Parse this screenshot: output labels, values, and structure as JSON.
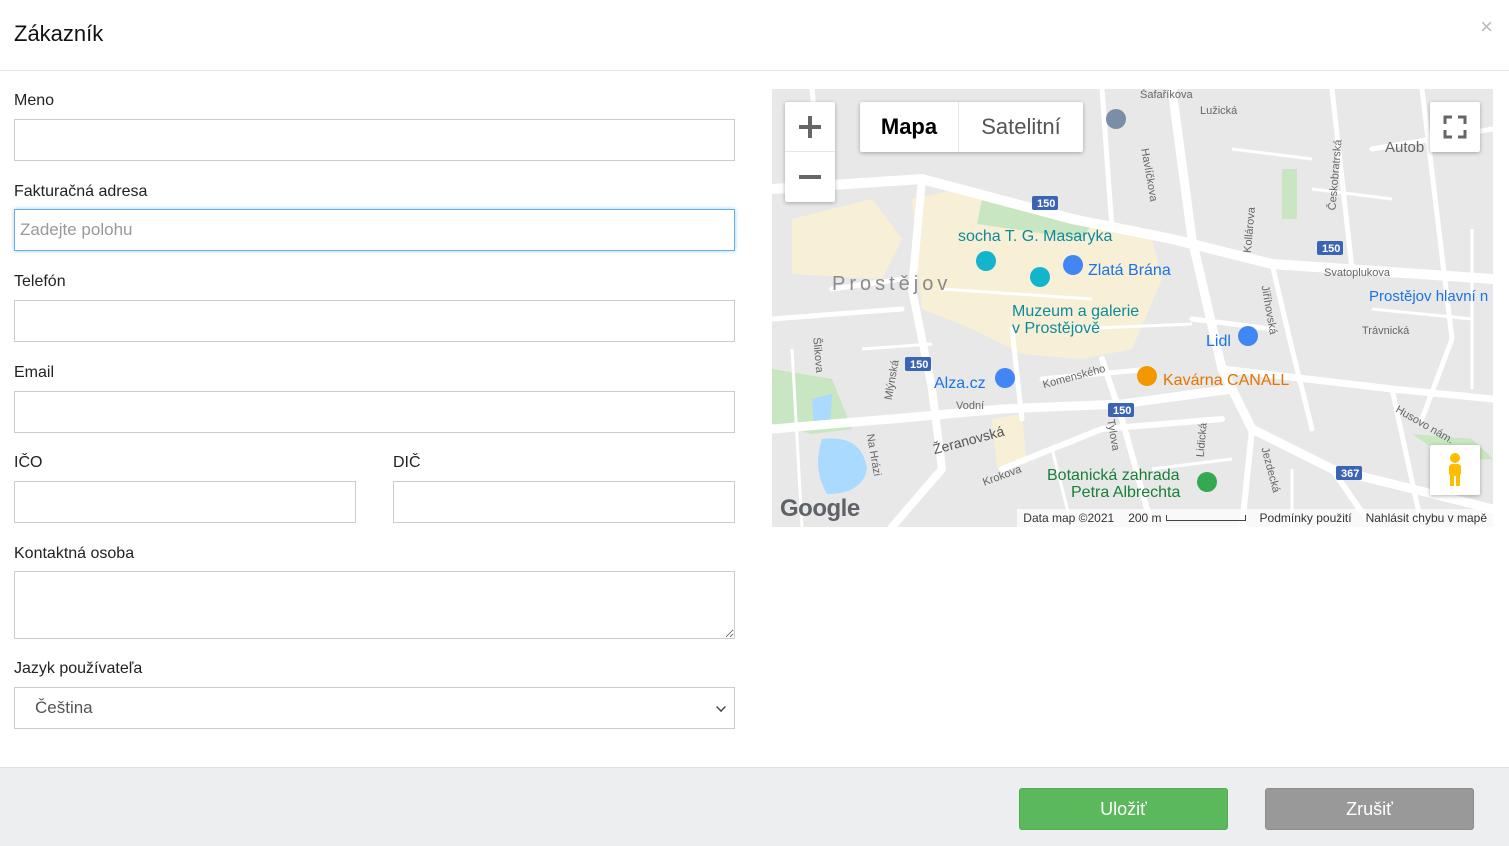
{
  "header": {
    "title": "Zákazník",
    "close": "×"
  },
  "form": {
    "name_label": "Meno",
    "name_value": "",
    "billing_label": "Fakturačná adresa",
    "billing_placeholder": "Zadejte polohu",
    "phone_label": "Telefón",
    "phone_value": "",
    "email_label": "Email",
    "email_value": "",
    "ico_label": "IČO",
    "dic_label": "DIČ",
    "contact_label": "Kontaktná osoba",
    "language_label": "Jazyk používateľa",
    "language_selected": "Čeština"
  },
  "map": {
    "type_map": "Mapa",
    "type_satellite": "Satelitní",
    "logo": "Google",
    "attribution": "Data map ©2021",
    "scale": "200 m",
    "terms": "Podmínky použití",
    "report": "Nahlásit chybu v mapě",
    "labels": {
      "city": "Prostějov",
      "masaryk": "socha T. G. Masaryka",
      "zlata_brana": "Zlatá Brána",
      "museum_1": "Muzeum a galerie",
      "museum_2": "v Prostějově",
      "lidl": "Lidl",
      "alza": "Alza.cz",
      "kavarna": "Kavárna CANALL",
      "botanic_1": "Botanická zahrada",
      "botanic_2": "Petra Albrechta",
      "station": "Prostějov hlavní n",
      "autob": "Autob",
      "zeranovska": "Žeranovská",
      "svatoplukova": "Svatoplukova",
      "travnicka": "Trávnická",
      "komenskeho": "Komenského",
      "vodni": "Vodní",
      "krokova": "Krokova",
      "tylova": "Tylova",
      "lidicka": "Lidická",
      "jezdecka": "Jezdecká",
      "husovo": "Husovo nám.",
      "mlynska": "Mlýnská",
      "na_hrazi": "Na Hrázi",
      "sikova": "Šlikova",
      "havlickova": "Havlíčkova",
      "ceskobratrska": "Českobratrská",
      "jilhovska": "Jiříhovská",
      "kollarova": "Kollárova",
      "lutzka": "Lužická",
      "safarikova": "Šafaříkova",
      "road_150": "150",
      "road_367": "367"
    }
  },
  "footer": {
    "save": "Uložiť",
    "cancel": "Zrušiť"
  },
  "colors": {
    "save": "#5cb85c",
    "cancel": "#999999",
    "focus": "#66afe9"
  }
}
